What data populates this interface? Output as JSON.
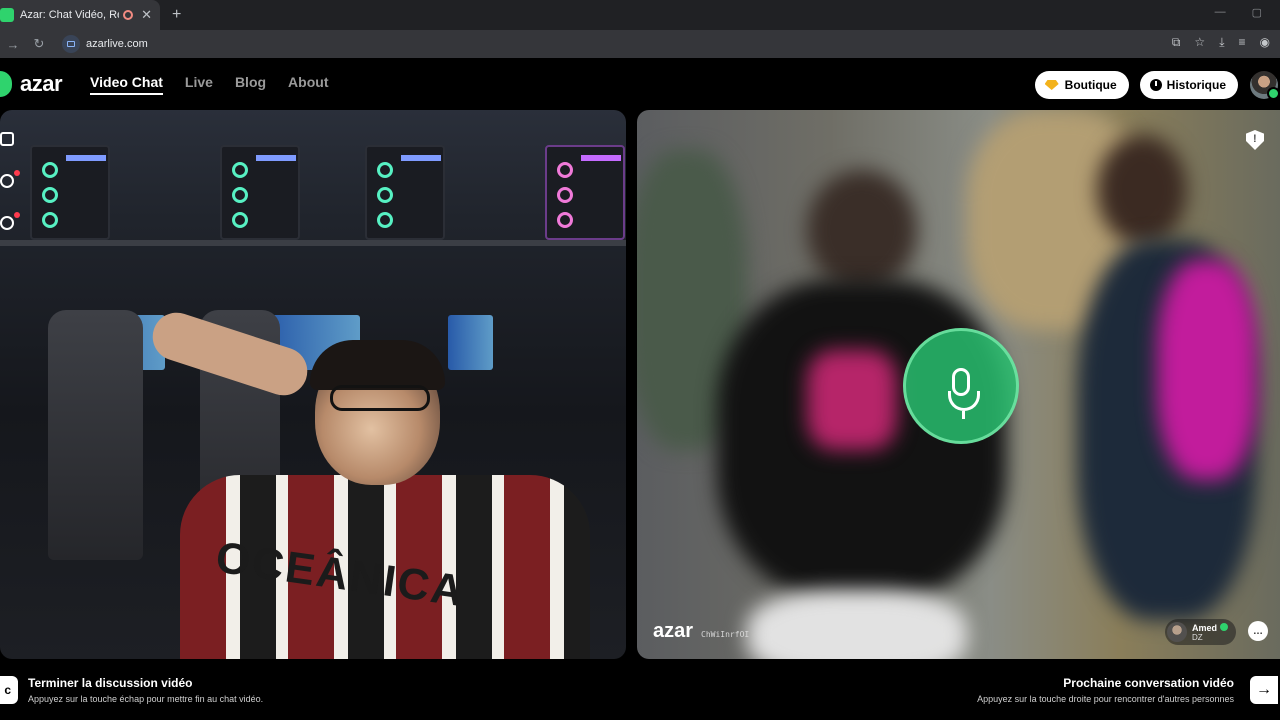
{
  "browser": {
    "tab_title": "Azar: Chat Vidéo, Rencontre",
    "tab_close": "✕",
    "new_tab": "+",
    "url": "azarlive.com",
    "nav_forward": "→",
    "nav_reload": "↻",
    "window_minimize": "—",
    "window_restore": "▢"
  },
  "header": {
    "logo_text": "azar",
    "nav": [
      {
        "label": "Video Chat",
        "active": true
      },
      {
        "label": "Live",
        "active": false
      },
      {
        "label": "Blog",
        "active": false
      },
      {
        "label": "About",
        "active": false
      }
    ],
    "boutique_label": "Boutique",
    "historique_label": "Historique"
  },
  "local_video": {
    "jersey_text": "OCEÂNICA"
  },
  "remote_video": {
    "watermark": "azar",
    "watermark_code": "ChWiInrfOI",
    "peer_name": "Amed",
    "peer_country": "DZ",
    "chat_icon": "…"
  },
  "footer": {
    "esc_key": "c",
    "end_title": "Terminer la discussion vidéo",
    "end_sub": "Appuyez sur la touche échap pour mettre fin au chat vidéo.",
    "next_title": "Prochaine conversation vidéo",
    "next_sub": "Appuyez sur la touche droite pour rencontrer d'autres personnes",
    "next_key": "→"
  },
  "colors": {
    "brand_green": "#2fd36d",
    "mic_green": "#28be6e",
    "boutique_gem": "#f3b21b"
  },
  "icons": [
    "favicon-icon",
    "record-icon",
    "close-icon",
    "forward-icon",
    "reload-icon",
    "site-video-icon",
    "install-icon",
    "star-icon",
    "download-icon",
    "playlist-icon",
    "profile-icon",
    "gem-icon",
    "clock-icon",
    "microphone-icon",
    "shield-icon",
    "chat-bubble-icon",
    "arrow-right-icon"
  ]
}
